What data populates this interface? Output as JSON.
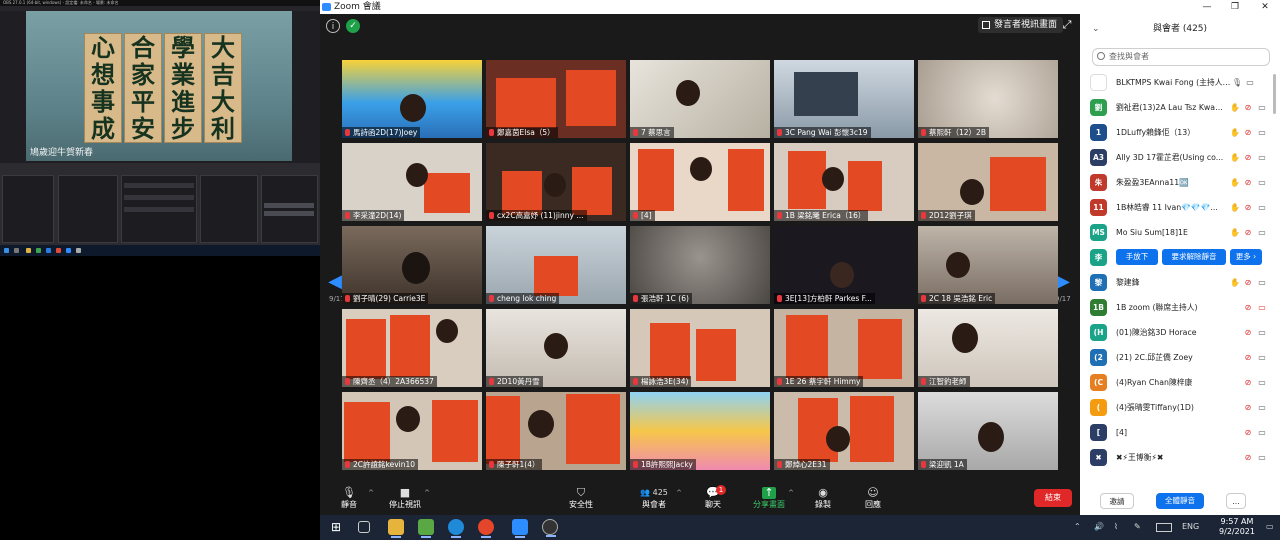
{
  "obs": {
    "title": "OBS 27.0.1 (64-bit, windows) - 設定檔: 未命名 - 場景: 未命名",
    "preview_caption": "鳩歲迎牛賀新春",
    "calligraphy": [
      "大吉大利",
      "學業進步",
      "合家平安",
      "心想事成"
    ]
  },
  "zoom": {
    "window_title": "Zoom 會議",
    "speaker_view_label": "發言者視訊畫面",
    "page_indicator": "9/17",
    "tiles": [
      {
        "name": "馬詩函2D(17)Joey"
      },
      {
        "name": "鄭嘉茵Elsa（5）"
      },
      {
        "name": "7 蔡思言"
      },
      {
        "name": "3C Pang Wai 彭懷3c19"
      },
      {
        "name": "蔡熙軒（12）2B"
      },
      {
        "name": "李采潼2D(14)"
      },
      {
        "name": "cx2C高嘉妤 (11)jinny ..."
      },
      {
        "name": "[4]"
      },
      {
        "name": "1B 梁銘曦 Erica（16）"
      },
      {
        "name": "2D12劉子琪"
      },
      {
        "name": "劉子晴(29) Carrie3E"
      },
      {
        "name": "cheng lok ching"
      },
      {
        "name": "張浩軒 1C  (6)"
      },
      {
        "name": "3E[13]方柏軒 Parkes F..."
      },
      {
        "name": "2C 18 吳浩銘 Eric"
      },
      {
        "name": "陳齊丞（4）2A366537"
      },
      {
        "name": "2D10黃丹雪"
      },
      {
        "name": "楊詠浩3E(34)"
      },
      {
        "name": "1E 26 蔡宇軒 Himmy"
      },
      {
        "name": "江智釣老師"
      },
      {
        "name": "2C許誼銘kevin10"
      },
      {
        "name": "陳子軒1(4）"
      },
      {
        "name": "1B許熙熙Jacky"
      },
      {
        "name": "鄭焯心2E31"
      },
      {
        "name": "梁迎凱 1A"
      }
    ],
    "toolbar": {
      "mute": "靜音",
      "stop_video": "停止視訊",
      "security": "安全性",
      "participants": "與會者",
      "participants_count": "425",
      "chat": "聊天",
      "chat_badge": "1",
      "share": "分享畫面",
      "record": "錄製",
      "reactions": "回應",
      "end": "結束"
    }
  },
  "participants": {
    "header": "與會者 (425)",
    "search_placeholder": "查找與會者",
    "rows": [
      {
        "initials": "",
        "color": "#ffffff",
        "name": "BLKTMPS Kwai Fong (主持人, 我)"
      },
      {
        "initials": "劉",
        "color": "#2e9e4f",
        "name": "劉祉君(13)2A Lau Tsz Kwan..."
      },
      {
        "initials": "1",
        "color": "#1f4e8c",
        "name": "1DLuffy賴鋒佢（13）"
      },
      {
        "initials": "A3",
        "color": "#2c3e66",
        "name": "Ally 3D 17霍芷君(Using co..."
      },
      {
        "initials": "朱",
        "color": "#c0392b",
        "name": "朱盈盈3EAnna11🆗"
      },
      {
        "initials": "11",
        "color": "#c0392b",
        "name": "1B林皓睿 11 Ivan💎💎💎..."
      },
      {
        "initials": "MS",
        "color": "#1aa387",
        "name": "Mo Siu Sum[18]1E"
      },
      {
        "initials": "李",
        "color": "#1aa387",
        "name": ""
      },
      {
        "initials": "黎",
        "color": "#1f6fb5",
        "name": "黎建鋒"
      },
      {
        "initials": "1B",
        "color": "#2e7d32",
        "name": "1B zoom (聯席主持人)"
      },
      {
        "initials": "(H",
        "color": "#1aa387",
        "name": "(01)陳治銘3D Horace"
      },
      {
        "initials": "(2",
        "color": "#1f6fb5",
        "name": "(21) 2C.邱芷僑 Zoey"
      },
      {
        "initials": "(C",
        "color": "#e67e22",
        "name": "(4)Ryan Chan陳梓康"
      },
      {
        "initials": "(",
        "color": "#f39c12",
        "name": "(4)張晴雯Tiffany(1D)"
      },
      {
        "initials": "[",
        "color": "#2c3e66",
        "name": "[4]"
      },
      {
        "initials": "",
        "color": "#2c3e66",
        "name": "✖⚡王博衡⚡✖"
      }
    ],
    "row_buttons": {
      "lower_hand": "手放下",
      "ask_unmute": "要求解除靜音",
      "more": "更多 ›"
    },
    "invite": "邀請",
    "mute_all": "全體靜音",
    "more": "..."
  },
  "taskbar": {
    "lang": "ENG",
    "time": "9:57 AM",
    "date": "9/2/2021"
  }
}
